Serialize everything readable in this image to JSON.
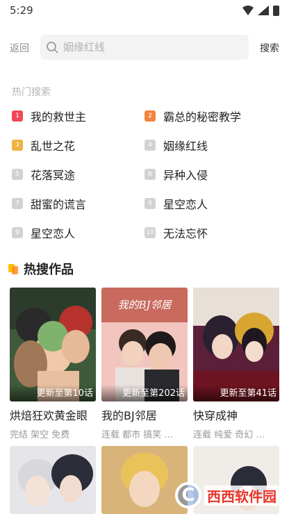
{
  "status_bar": {
    "time": "5:29"
  },
  "search": {
    "back_label": "返回",
    "placeholder": "姻缘红线",
    "search_label": "搜索"
  },
  "hot_search": {
    "title": "热门搜索",
    "items": [
      {
        "rank": "1",
        "label": "我的救世主"
      },
      {
        "rank": "2",
        "label": "霸总的秘密教学"
      },
      {
        "rank": "3",
        "label": "乱世之花"
      },
      {
        "rank": "4",
        "label": "姻缘红线"
      },
      {
        "rank": "5",
        "label": "花落冥途"
      },
      {
        "rank": "6",
        "label": "异种入侵"
      },
      {
        "rank": "7",
        "label": "甜蜜的谎言"
      },
      {
        "rank": "8",
        "label": "星空恋人"
      },
      {
        "rank": "9",
        "label": "星空恋人"
      },
      {
        "rank": "10",
        "label": "无法忘怀"
      }
    ]
  },
  "works": {
    "title": "热搜作品",
    "cards": [
      {
        "title": "烘焙狂欢黄金眼",
        "update": "更新至第10话",
        "tags": "完结 架空 免费"
      },
      {
        "title": "我的BJ邻居",
        "update": "更新至第202话",
        "tags": "连载 都市 搞笑 …"
      },
      {
        "title": "快穿成神",
        "update": "更新至第41话",
        "tags": "连载 纯爱 奇幻 …"
      }
    ]
  },
  "watermark": {
    "text": "西西软件园",
    "logo": "C"
  }
}
